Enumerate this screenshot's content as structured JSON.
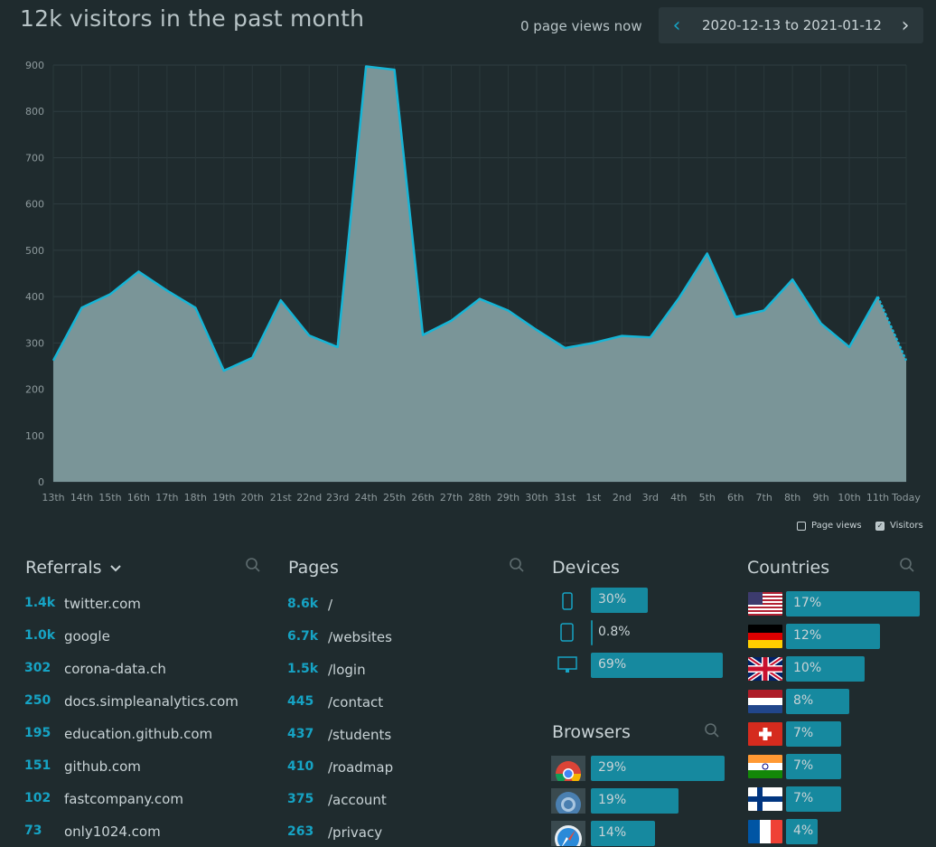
{
  "header": {
    "title": "12k visitors in the past month",
    "page_views_now": "0 page views now",
    "date_range": "2020-12-13 to 2021-01-12"
  },
  "chart_data": {
    "type": "area",
    "categories": [
      "13th",
      "14th",
      "15th",
      "16th",
      "17th",
      "18th",
      "19th",
      "20th",
      "21st",
      "22nd",
      "23rd",
      "24th",
      "25th",
      "26th",
      "27th",
      "28th",
      "29th",
      "30th",
      "31st",
      "1st",
      "2nd",
      "3rd",
      "4th",
      "5th",
      "6th",
      "7th",
      "8th",
      "9th",
      "10th",
      "11th",
      "Today"
    ],
    "series": [
      {
        "name": "Visitors",
        "values": [
          262,
          376,
          405,
          454,
          413,
          376,
          240,
          268,
          392,
          316,
          291,
          897,
          890,
          317,
          348,
          395,
          370,
          328,
          289,
          300,
          315,
          312,
          396,
          493,
          356,
          370,
          437,
          342,
          291,
          400,
          262
        ]
      }
    ],
    "ylim": [
      0,
      900
    ],
    "yticks": [
      0,
      100,
      200,
      300,
      400,
      500,
      600,
      700,
      800,
      900
    ],
    "grid": true,
    "colors": {
      "line": "#16b5d6",
      "fill": "#7a9598"
    }
  },
  "legend": {
    "page_views": {
      "label": "Page views",
      "checked": false
    },
    "visitors": {
      "label": "Visitors",
      "checked": true
    }
  },
  "referrals": {
    "title": "Referrals",
    "items": [
      {
        "count": "1.4k",
        "label": "twitter.com"
      },
      {
        "count": "1.0k",
        "label": "google"
      },
      {
        "count": "302",
        "label": "corona-data.ch"
      },
      {
        "count": "250",
        "label": "docs.simpleanalytics.com"
      },
      {
        "count": "195",
        "label": "education.github.com"
      },
      {
        "count": "151",
        "label": "github.com"
      },
      {
        "count": "102",
        "label": "fastcompany.com"
      },
      {
        "count": "73",
        "label": "only1024.com"
      }
    ]
  },
  "pages": {
    "title": "Pages",
    "items": [
      {
        "count": "8.6k",
        "label": "/"
      },
      {
        "count": "6.7k",
        "label": "/websites"
      },
      {
        "count": "1.5k",
        "label": "/login"
      },
      {
        "count": "445",
        "label": "/contact"
      },
      {
        "count": "437",
        "label": "/students"
      },
      {
        "count": "410",
        "label": "/roadmap"
      },
      {
        "count": "375",
        "label": "/account"
      },
      {
        "count": "263",
        "label": "/privacy"
      }
    ]
  },
  "devices": {
    "title": "Devices",
    "items": [
      {
        "icon": "mobile-icon",
        "percent": "30%",
        "value": 0.3
      },
      {
        "icon": "tablet-icon",
        "percent": "0.8%",
        "value": 0.008
      },
      {
        "icon": "desktop-icon",
        "percent": "69%",
        "value": 0.69
      }
    ]
  },
  "browsers": {
    "title": "Browsers",
    "items": [
      {
        "icon": "chrome-icon",
        "percent": "29%",
        "value": 0.29
      },
      {
        "icon": "chromium-icon",
        "percent": "19%",
        "value": 0.19
      },
      {
        "icon": "safari-icon",
        "percent": "14%",
        "value": 0.14
      }
    ]
  },
  "countries": {
    "title": "Countries",
    "items": [
      {
        "icon": "us-flag-icon",
        "percent": "17%",
        "value": 0.17
      },
      {
        "icon": "germany-flag-icon",
        "percent": "12%",
        "value": 0.12
      },
      {
        "icon": "uk-flag-icon",
        "percent": "10%",
        "value": 0.1
      },
      {
        "icon": "netherlands-flag-icon",
        "percent": "8%",
        "value": 0.08
      },
      {
        "icon": "switzerland-flag-icon",
        "percent": "7%",
        "value": 0.07
      },
      {
        "icon": "india-flag-icon",
        "percent": "7%",
        "value": 0.07
      },
      {
        "icon": "finland-flag-icon",
        "percent": "7%",
        "value": 0.07
      },
      {
        "icon": "france-flag-icon",
        "percent": "4%",
        "value": 0.04
      }
    ]
  }
}
